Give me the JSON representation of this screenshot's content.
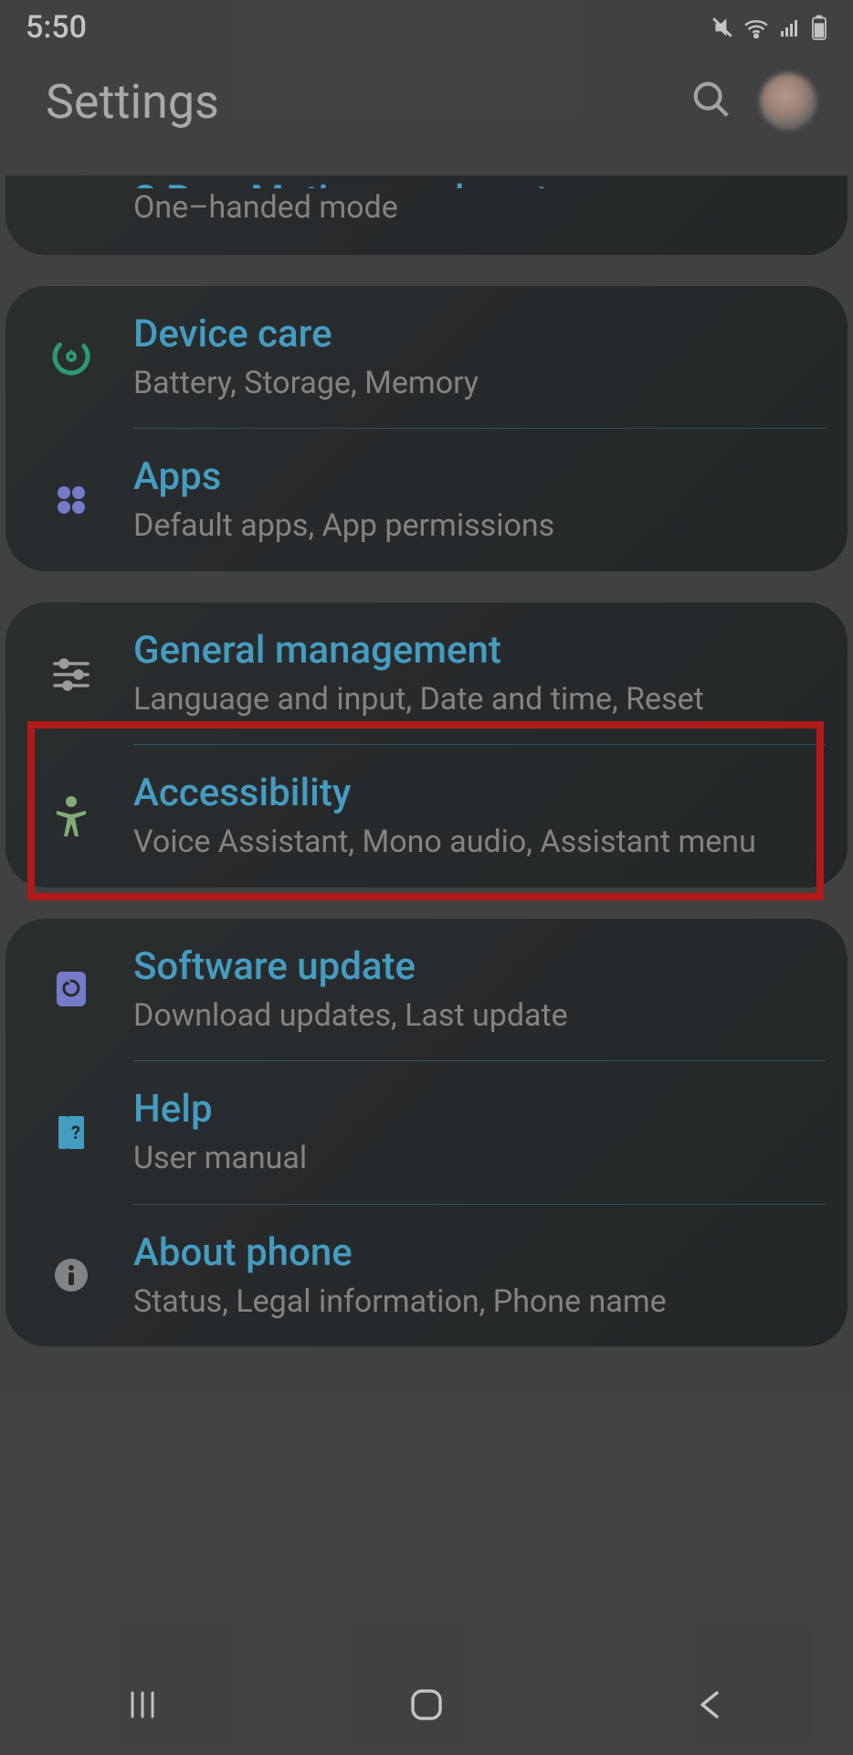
{
  "status": {
    "time": "5:50"
  },
  "header": {
    "title": "Settings"
  },
  "partial": {
    "title": "S Pen, Motions and gestures,",
    "sub": "One–handed mode"
  },
  "groups": [
    {
      "items": [
        {
          "key": "device-care",
          "icon": "device-care-icon",
          "title": "Device care",
          "sub": "Battery, Storage, Memory"
        },
        {
          "key": "apps",
          "icon": "apps-icon",
          "title": "Apps",
          "sub": "Default apps, App permissions"
        }
      ]
    },
    {
      "items": [
        {
          "key": "general-management",
          "icon": "sliders-icon",
          "title": "General management",
          "sub": "Language and input, Date and time, Reset",
          "highlighted": true
        },
        {
          "key": "accessibility",
          "icon": "accessibility-icon",
          "title": "Accessibility",
          "sub": "Voice Assistant, Mono audio, Assistant menu"
        }
      ]
    },
    {
      "items": [
        {
          "key": "software-update",
          "icon": "software-update-icon",
          "title": "Software update",
          "sub": "Download updates, Last update"
        },
        {
          "key": "help",
          "icon": "help-icon",
          "title": "Help",
          "sub": "User manual"
        },
        {
          "key": "about-phone",
          "icon": "info-icon",
          "title": "About phone",
          "sub": "Status, Legal information, Phone name"
        }
      ]
    }
  ]
}
